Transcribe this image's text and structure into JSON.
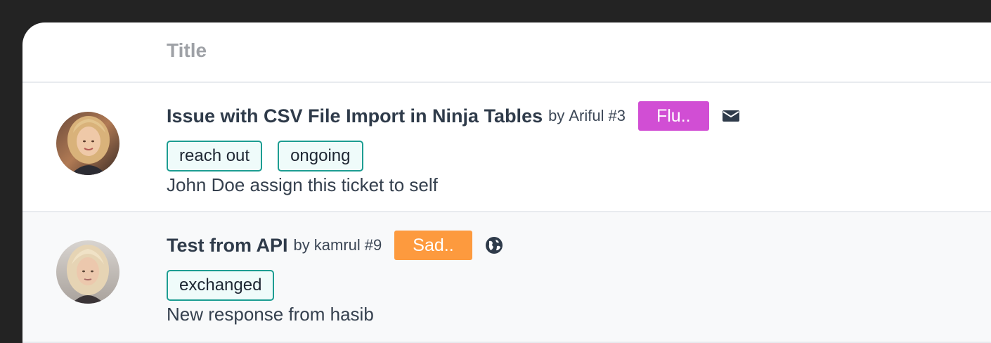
{
  "table": {
    "header": {
      "title": "Title"
    },
    "rows": [
      {
        "title": "Issue with CSV File Import in Ninja Tables",
        "by": "by",
        "author": "Ariful",
        "ticket_no": "#3",
        "mood": {
          "label": "Flu..",
          "color": "#d14ed4"
        },
        "channel_icon": "envelope-icon",
        "tags": [
          "reach out",
          "ongoing"
        ],
        "activity": "John Doe assign this ticket to self"
      },
      {
        "title": "Test from API",
        "by": "by",
        "author": "kamrul",
        "ticket_no": "#9",
        "mood": {
          "label": "Sad..",
          "color": "#fd9a3e"
        },
        "channel_icon": "globe-icon",
        "tags": [
          "exchanged"
        ],
        "activity": "New response from hasib"
      }
    ]
  },
  "colors": {
    "tag_border": "#1d9d92",
    "row_alt_bg": "#f8f9fa",
    "backdrop": "#232323"
  }
}
